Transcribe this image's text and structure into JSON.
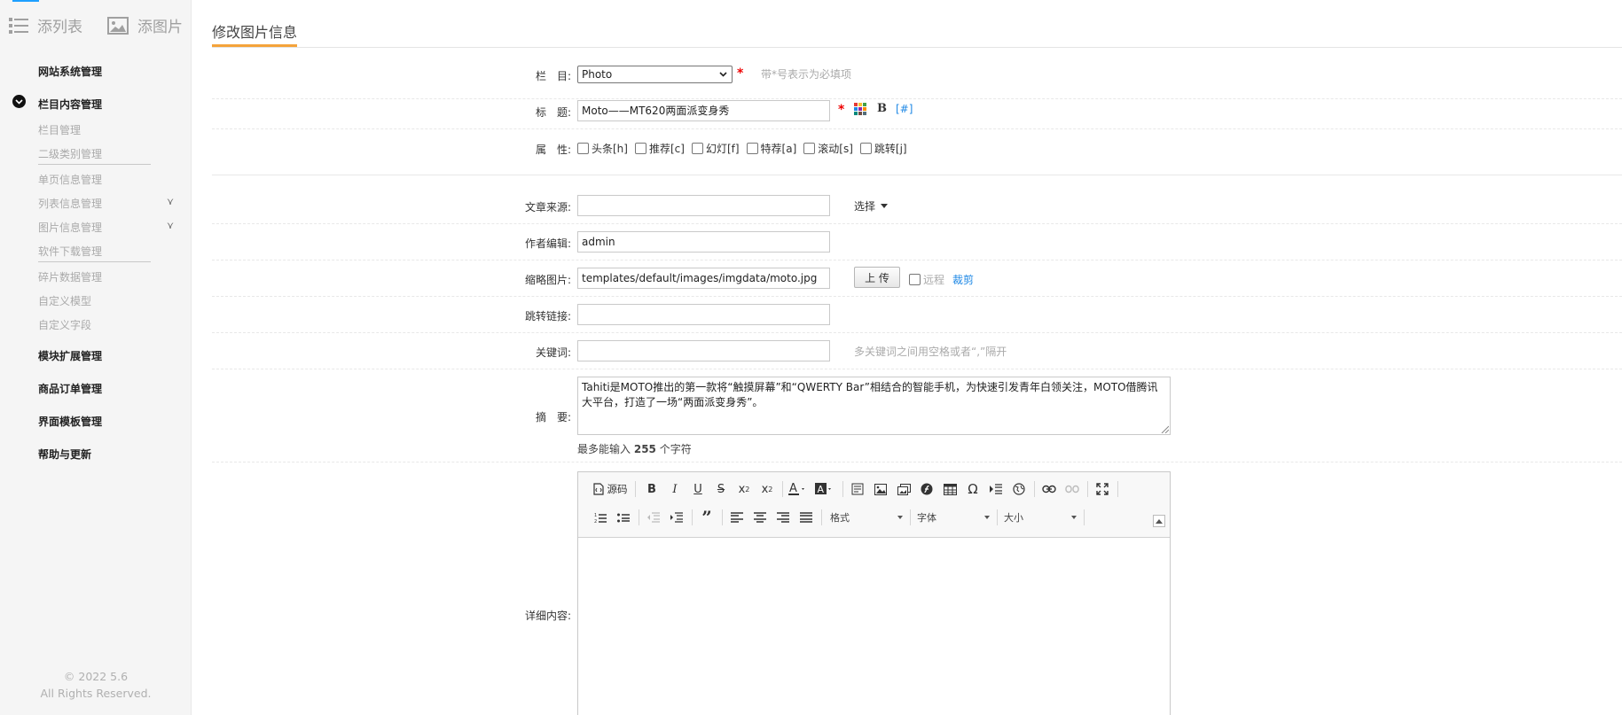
{
  "sidebar": {
    "tabs": [
      {
        "label": "添列表",
        "icon": "list-icon"
      },
      {
        "label": "添图片",
        "icon": "image-icon"
      }
    ],
    "groups": [
      {
        "label": "网站系统管理"
      },
      {
        "label": "栏目内容管理",
        "expanded": true,
        "items": [
          "栏目管理",
          "二级类别管理",
          "单页信息管理",
          "列表信息管理",
          "图片信息管理",
          "软件下载管理",
          "碎片数据管理",
          "自定义模型",
          "自定义字段"
        ]
      },
      {
        "label": "模块扩展管理"
      },
      {
        "label": "商品订单管理"
      },
      {
        "label": "界面模板管理"
      },
      {
        "label": "帮助与更新"
      }
    ],
    "copyright_line1": "© 2022 5.6",
    "copyright_line2": "All Rights Reserved."
  },
  "main": {
    "page_title": "修改图片信息",
    "form": {
      "column": {
        "label": "栏　目:",
        "value": "Photo",
        "required_mark": "*",
        "hint": "带*号表示为必填项"
      },
      "title": {
        "label": "标　题:",
        "value": "Moto——MT620两面派变身秀",
        "required_mark": "*",
        "bold_label": "B",
        "link_label": "[#]"
      },
      "attributes": {
        "label": "属　性:",
        "options": [
          "头条[h]",
          "推荐[c]",
          "幻灯[f]",
          "特荐[a]",
          "滚动[s]",
          "跳转[j]"
        ]
      },
      "source": {
        "label": "文章来源:",
        "value": "",
        "select_label": "选择"
      },
      "author": {
        "label": "作者编辑:",
        "value": "admin"
      },
      "thumbnail": {
        "label": "缩略图片:",
        "value": "templates/default/images/imgdata/moto.jpg",
        "upload_label": "上 传",
        "remote_label": "远程",
        "crop_label": "裁剪"
      },
      "redirect": {
        "label": "跳转链接:",
        "value": ""
      },
      "keywords": {
        "label": "关键词:",
        "value": "",
        "hint": "多关键词之间用空格或者“,”隔开"
      },
      "summary": {
        "label": "摘　要:",
        "value": "Tahiti是MOTO推出的第一款将“触摸屏幕”和“QWERTY Bar”相结合的智能手机，为快速引发青年白领关注，MOTO借腾讯大平台，打造了一场“两面派变身秀”。",
        "limit_prefix": "最多能输入",
        "limit_value": "255",
        "limit_suffix": "个字符"
      },
      "content": {
        "label": "详细内容:"
      }
    },
    "editor": {
      "source_label": "源码",
      "format_label": "格式",
      "font_label": "字体",
      "size_label": "大小"
    }
  },
  "colors": {
    "accent": "#f4a33b",
    "link": "#1e88e5",
    "required": "#e00000"
  }
}
